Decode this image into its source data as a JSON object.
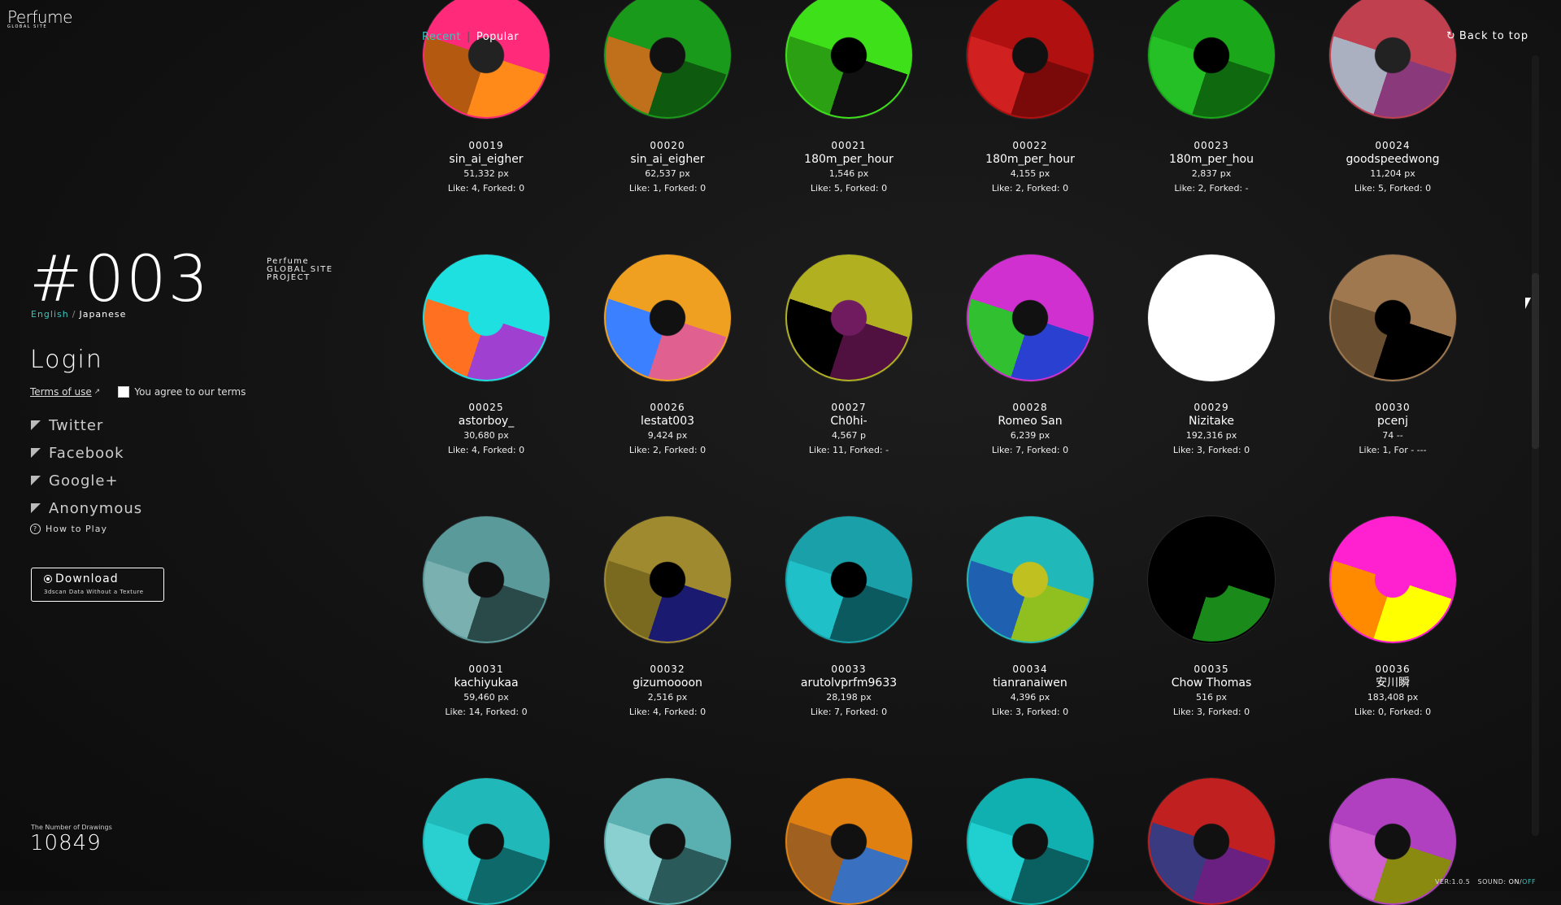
{
  "logo": {
    "main": "Perfume",
    "sub": "GLOBAL SITE"
  },
  "project": {
    "number": "#003",
    "side": [
      "Perfume",
      "GLOBAL SITE",
      "PROJECT"
    ]
  },
  "lang": {
    "english": "English",
    "sep": "/",
    "japanese": "Japanese"
  },
  "login": {
    "title": "Login",
    "terms_link": "Terms of use",
    "agree": "You agree to our terms",
    "options": [
      "Twitter",
      "Facebook",
      "Google+",
      "Anonymous"
    ],
    "how_to": "How to Play"
  },
  "download": {
    "label": "Download",
    "sub": "3dscan Data Without a Texture"
  },
  "counter": {
    "label": "The Number of Drawings",
    "value": "10849"
  },
  "tabs": {
    "recent": "Recent",
    "sep": "|",
    "popular": "Popular"
  },
  "back_to_top": "Back to top",
  "version": {
    "ver": "VER:1.0.5",
    "sound": "SOUND:",
    "on": "ON",
    "slash": "/",
    "off": "OFF"
  },
  "cards": [
    {
      "id": "00019",
      "name": "sin_ai_eigher",
      "px": "51,332 px",
      "like": "Like: 4, Forked: 0",
      "colors": [
        "#ff2a7a",
        "#ff8a1a",
        "#b35a10",
        "#222"
      ]
    },
    {
      "id": "00020",
      "name": "sin_ai_eigher",
      "px": "62,537 px",
      "like": "Like: 1, Forked: 0",
      "colors": [
        "#1a9a1a",
        "#0e5a0e",
        "#c0701a",
        "#111"
      ]
    },
    {
      "id": "00021",
      "name": "180m_per_hour",
      "px": "1,546 px",
      "like": "Like: 5, Forked: 0",
      "colors": [
        "#3ee01a",
        "#111",
        "#2aa012",
        "#000"
      ]
    },
    {
      "id": "00022",
      "name": "180m_per_hour",
      "px": "4,155 px",
      "like": "Like: 2, Forked: 0",
      "colors": [
        "#b01010",
        "#7a0a0a",
        "#d02020",
        "#111"
      ]
    },
    {
      "id": "00023",
      "name": "180m_per_hou",
      "px": "2,837 px",
      "like": "Like: 2, Forked: -",
      "colors": [
        "#1aa81a",
        "#0f6a0f",
        "#25c025",
        "#000"
      ]
    },
    {
      "id": "00024",
      "name": "goodspeedwong",
      "px": "11,204 px",
      "like": "Like: 5, Forked: 0",
      "colors": [
        "#c04050",
        "#8a3a7a",
        "#aab0c0",
        "#222"
      ]
    },
    {
      "id": "00025",
      "name": "astorboy_",
      "px": "30,680 px",
      "like": "Like: 4, Forked: 0",
      "colors": [
        "#1ee0e0",
        "#a040d0",
        "#ff7020",
        "#1ee0e0"
      ]
    },
    {
      "id": "00026",
      "name": "lestat003",
      "px": "9,424 px",
      "like": "Like: 2, Forked: 0",
      "colors": [
        "#f0a020",
        "#e06090",
        "#3a80ff",
        "#111"
      ]
    },
    {
      "id": "00027",
      "name": "Ch0hi-",
      "px": "4,567 p",
      "like": "Like: 11, Forked: -",
      "colors": [
        "#b0b020",
        "#501040",
        "#000",
        "#701a60"
      ]
    },
    {
      "id": "00028",
      "name": "Romeo San",
      "px": "6,239 px",
      "like": "Like: 7, Forked: 0",
      "colors": [
        "#d030d0",
        "#2a40d0",
        "#30c030",
        "#111"
      ]
    },
    {
      "id": "00029",
      "name": "Nizitake",
      "px": "192,316 px",
      "like": "Like: 3, Forked: 0",
      "colors": [
        "#ffffff",
        "#ffffff",
        "#ffffff",
        "#ffffff"
      ]
    },
    {
      "id": "00030",
      "name": "pcenj",
      "px": "74 --",
      "like": "Like: 1, For - ---",
      "colors": [
        "#a07850",
        "#000",
        "#6a5030",
        "#000"
      ]
    },
    {
      "id": "00031",
      "name": "kachiyukaa",
      "px": "59,460 px",
      "like": "Like: 14, Forked: 0",
      "colors": [
        "#5a9a9a",
        "#2a4a4a",
        "#7ab0b0",
        "#111"
      ]
    },
    {
      "id": "00032",
      "name": "gizumoooon",
      "px": "2,516 px",
      "like": "Like: 4, Forked: 0",
      "colors": [
        "#a08a30",
        "#1a1a70",
        "#7a6a20",
        "#000"
      ]
    },
    {
      "id": "00033",
      "name": "arutolvprfm9633",
      "px": "28,198 px",
      "like": "Like: 7, Forked: 0",
      "colors": [
        "#1aa0a8",
        "#0a5a60",
        "#20c0c8",
        "#000"
      ]
    },
    {
      "id": "00034",
      "name": "tianranaiwen",
      "px": "4,396 px",
      "like": "Like: 3, Forked: 0",
      "colors": [
        "#20b8b8",
        "#90c020",
        "#2060b0",
        "#c0c020"
      ]
    },
    {
      "id": "00035",
      "name": "Chow Thomas",
      "px": "516 px",
      "like": "Like: 3, Forked: 0",
      "colors": [
        "#000",
        "#1a8a1a",
        "#000",
        "#000"
      ]
    },
    {
      "id": "00036",
      "name": "安川瞬",
      "px": "183,408 px",
      "like": "Like: 0, Forked: 0",
      "colors": [
        "#ff20d0",
        "#ffff00",
        "#ff8a00",
        "#ff20d0"
      ]
    },
    {
      "id": "",
      "name": "",
      "px": "",
      "like": "",
      "colors": [
        "#20b8b8",
        "#0e6a6a",
        "#2ad0d0",
        "#111"
      ]
    },
    {
      "id": "",
      "name": "",
      "px": "",
      "like": "",
      "colors": [
        "#5ab0b0",
        "#2a5a5a",
        "#8ad0d0",
        "#111"
      ]
    },
    {
      "id": "",
      "name": "",
      "px": "",
      "like": "",
      "colors": [
        "#e08010",
        "#3a70c0",
        "#a06020",
        "#111"
      ]
    },
    {
      "id": "",
      "name": "",
      "px": "",
      "like": "",
      "colors": [
        "#10b0b0",
        "#0a6060",
        "#20d0d0",
        "#111"
      ]
    },
    {
      "id": "",
      "name": "",
      "px": "",
      "like": "",
      "colors": [
        "#c02020",
        "#6a2080",
        "#3a3a80",
        "#111"
      ]
    },
    {
      "id": "",
      "name": "",
      "px": "",
      "like": "",
      "colors": [
        "#b040c0",
        "#8a8a10",
        "#d060d0",
        "#111"
      ]
    }
  ]
}
